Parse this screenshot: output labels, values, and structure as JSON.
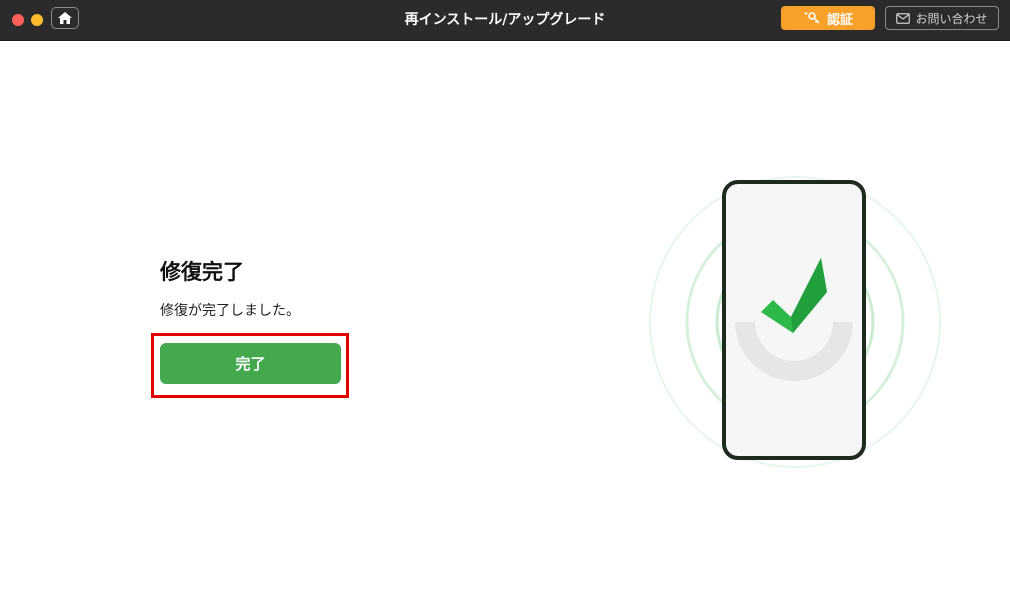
{
  "window": {
    "title": "再インストール/アップグレード"
  },
  "toolbar": {
    "auth_label": "認証",
    "contact_label": "お問い合わせ"
  },
  "main": {
    "heading": "修復完了",
    "message": "修復が完了しました。",
    "done_label": "完了"
  },
  "colors": {
    "titlebar": "#2b2b2b",
    "accent_orange": "#f7a12a",
    "success_green": "#44a84f",
    "highlight_red": "#e10000"
  },
  "icons": {
    "home": "home-icon",
    "auth": "key-sparkle-icon",
    "contact": "mail-icon",
    "illustration": "phone-checkmark-illustration"
  }
}
